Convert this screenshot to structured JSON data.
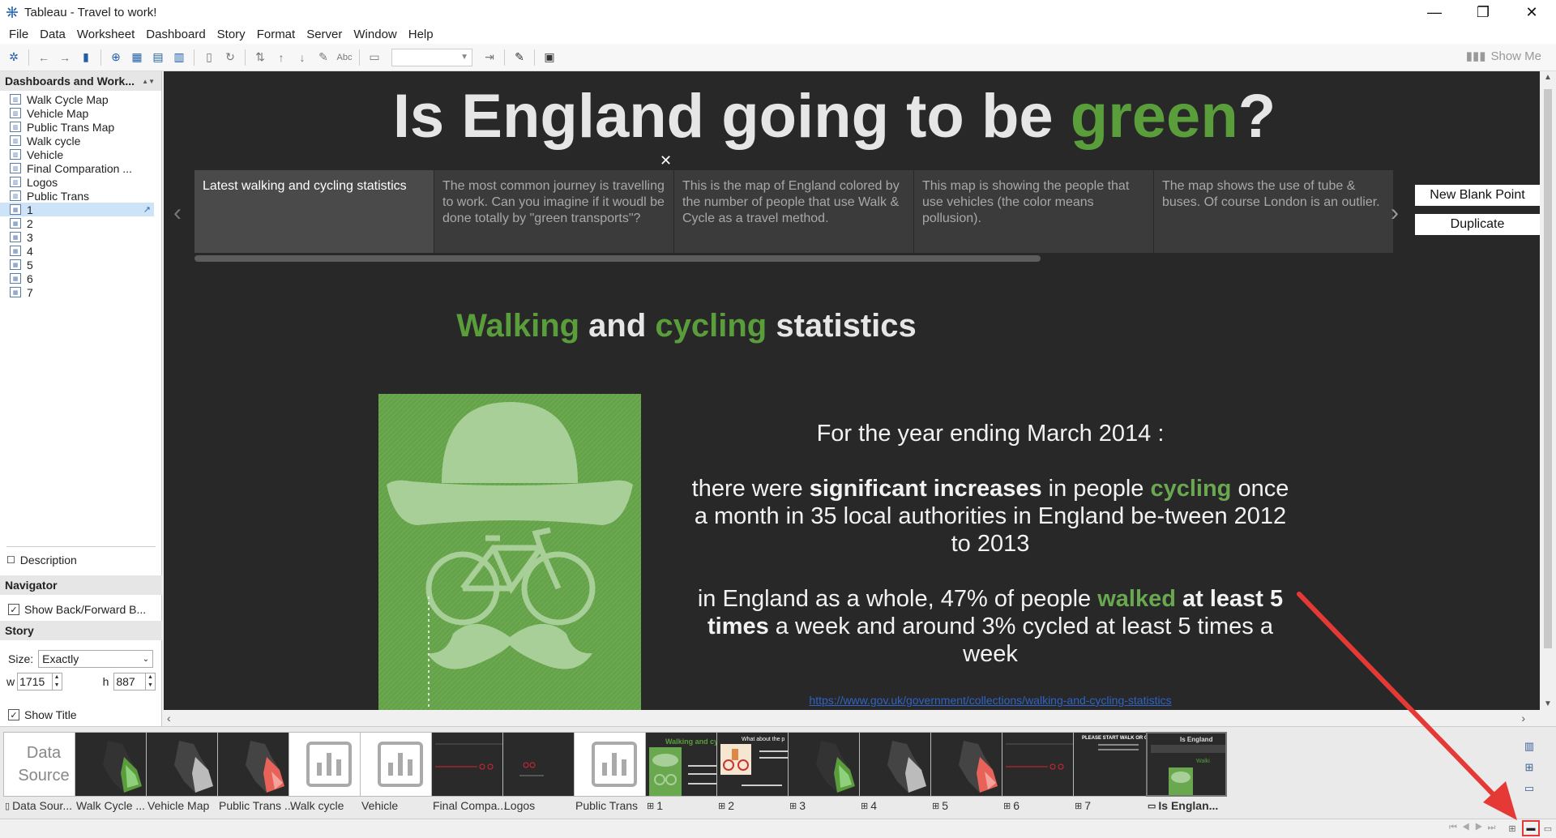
{
  "window": {
    "title": "Tableau - Travel to work!"
  },
  "menu": [
    "File",
    "Data",
    "Worksheet",
    "Dashboard",
    "Story",
    "Format",
    "Server",
    "Window",
    "Help"
  ],
  "toolbar": {
    "show_me": "Show Me",
    "abc": "Abc"
  },
  "sidebar": {
    "header": "Dashboards and Work...",
    "items": [
      {
        "label": "Walk Cycle Map",
        "kind": "worksheet"
      },
      {
        "label": "Vehicle Map",
        "kind": "worksheet"
      },
      {
        "label": "Public Trans Map",
        "kind": "worksheet"
      },
      {
        "label": "Walk cycle",
        "kind": "worksheet"
      },
      {
        "label": "Vehicle",
        "kind": "worksheet"
      },
      {
        "label": "Final Comparation ...",
        "kind": "worksheet"
      },
      {
        "label": "Logos",
        "kind": "worksheet"
      },
      {
        "label": "Public Trans",
        "kind": "worksheet"
      },
      {
        "label": "1",
        "kind": "dashboard"
      },
      {
        "label": "2",
        "kind": "dashboard"
      },
      {
        "label": "3",
        "kind": "dashboard"
      },
      {
        "label": "4",
        "kind": "dashboard"
      },
      {
        "label": "5",
        "kind": "dashboard"
      },
      {
        "label": "6",
        "kind": "dashboard"
      },
      {
        "label": "7",
        "kind": "dashboard"
      }
    ],
    "selected_index": 8,
    "description": "Description",
    "navigator": {
      "header": "Navigator",
      "show_back_forward": "Show Back/Forward B..."
    },
    "story": {
      "header": "Story",
      "size_label": "Size:",
      "size_value": "Exactly",
      "w_label": "w",
      "w_value": "1715",
      "h_label": "h",
      "h_value": "887",
      "show_title": "Show Title"
    }
  },
  "story": {
    "title_prefix": "Is England going to be ",
    "title_green": "green",
    "title_suffix": "?",
    "points": [
      "Latest walking and cycling statistics",
      "The most common journey is travelling to work. Can you imagine if it woudl be done totally by \"green transports\"?",
      "This is the map of England colored by the number of people that use Walk & Cycle as a travel method.",
      "This map is showing the people that use vehicles (the color means pollusion).",
      "The map shows the use of tube & buses. Of course London is an outlier."
    ],
    "active_point": 0,
    "new_blank_point": "New Blank Point",
    "duplicate": "Duplicate"
  },
  "dashboard": {
    "heading": {
      "w1": "Walking",
      "w2": " and ",
      "w3": "cycling",
      "w4": " statistics"
    },
    "intro": "For the year ending March 2014 :",
    "p1": {
      "a": "there were ",
      "b": "significant increases",
      "c": " in people ",
      "d": "cycling",
      "e": " once a month in 35 local authorities in England be-tween 2012 to 2013"
    },
    "p2": {
      "a": "in England as a whole, 47% of people ",
      "b": "walked",
      "c": " at least 5 times",
      "d": " a week and around 3% cycled at least 5 times a week"
    },
    "link": "https://www.gov.uk/government/collections/walking-and-cycling-statistics"
  },
  "filmstrip": {
    "data_source_line1": "Data",
    "data_source_line2": "Source",
    "tiles": [
      {
        "label": "Data Sour...",
        "type": "datasource"
      },
      {
        "label": "Walk Cycle ...",
        "type": "map-green"
      },
      {
        "label": "Vehicle Map",
        "type": "map-gray"
      },
      {
        "label": "Public Trans ...",
        "type": "map-red"
      },
      {
        "label": "Walk cycle",
        "type": "bars"
      },
      {
        "label": "Vehicle",
        "type": "bars"
      },
      {
        "label": "Final Compa...",
        "type": "line"
      },
      {
        "label": "Logos",
        "type": "logo"
      },
      {
        "label": "Public Trans",
        "type": "bars"
      },
      {
        "label": "1",
        "type": "dash1"
      },
      {
        "label": "2",
        "type": "dash2"
      },
      {
        "label": "3",
        "type": "map-green"
      },
      {
        "label": "4",
        "type": "map-gray"
      },
      {
        "label": "5",
        "type": "map-red"
      },
      {
        "label": "6",
        "type": "line"
      },
      {
        "label": "7",
        "type": "dash7"
      },
      {
        "label": "Is Englan...",
        "type": "story"
      }
    ]
  },
  "colors": {
    "green": "#5a9e3c",
    "canvas_bg": "#282828",
    "annotation": "#e53935"
  }
}
